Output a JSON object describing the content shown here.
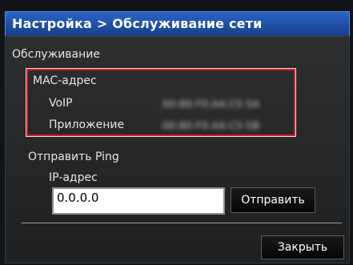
{
  "title": {
    "text": "Настройка > Обслуживание сети"
  },
  "maintenance": {
    "section_label": "Обслуживание",
    "mac": {
      "title": "MAC-адрес",
      "rows": [
        {
          "label": "VoIP",
          "value": "00:80:F0:A4:C5:5A"
        },
        {
          "label": "Приложение",
          "value": "00:80:F0:A4:C5:5B"
        }
      ]
    }
  },
  "ping": {
    "title": "Отправить Ping",
    "ip_label": "IP-адрес",
    "ip_value": "0.0.0.0",
    "send_label": "Отправить"
  },
  "footer": {
    "close_label": "Закрыть"
  }
}
